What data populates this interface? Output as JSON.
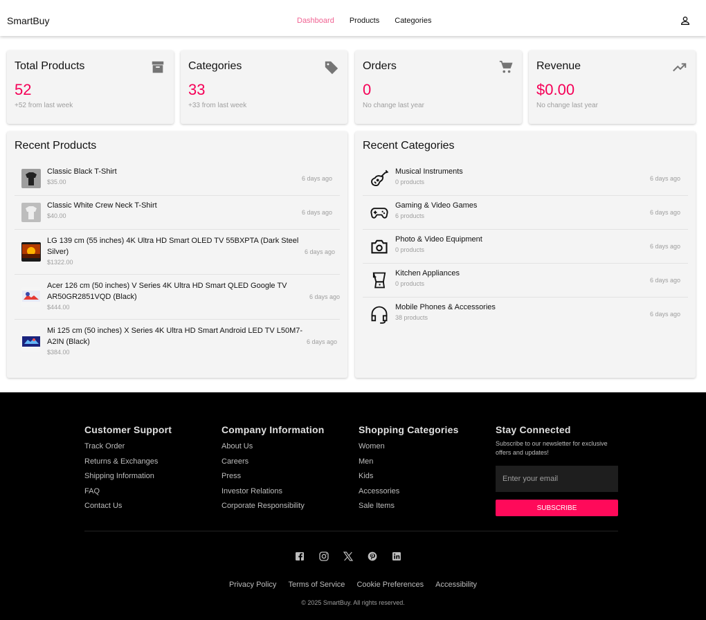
{
  "brand": "SmartBuy",
  "nav": {
    "links": [
      "Dashboard",
      "Products",
      "Categories"
    ],
    "active": "Dashboard"
  },
  "stats": [
    {
      "title": "Total Products",
      "value": "52",
      "sub": "+52 from last week",
      "icon": "archive-icon"
    },
    {
      "title": "Categories",
      "value": "33",
      "sub": "+33 from last week",
      "icon": "tag-icon"
    },
    {
      "title": "Orders",
      "value": "0",
      "sub": "No change last year",
      "icon": "cart-icon"
    },
    {
      "title": "Revenue",
      "value": "$0.00",
      "sub": "No change last year",
      "icon": "trending-up-icon"
    }
  ],
  "recent_products": {
    "title": "Recent Products",
    "items": [
      {
        "name": "Classic Black T-Shirt",
        "price": "$35.00",
        "time": "6 days ago"
      },
      {
        "name": "Classic White Crew Neck T-Shirt",
        "price": "$40.00",
        "time": "6 days ago"
      },
      {
        "name": "LG 139 cm (55 inches) 4K Ultra HD Smart OLED TV 55BXPTA (Dark Steel Silver)",
        "price": "$1322.00",
        "time": "6 days ago"
      },
      {
        "name": "Acer 126 cm (50 inches) V Series 4K Ultra HD Smart QLED Google TV AR50GR2851VQD (Black)",
        "price": "$444.00",
        "time": "6 days ago"
      },
      {
        "name": "Mi 125 cm (50 inches) X Series 4K Ultra HD Smart Android LED TV L50M7-A2IN (Black)",
        "price": "$384.00",
        "time": "6 days ago"
      }
    ]
  },
  "recent_categories": {
    "title": "Recent Categories",
    "items": [
      {
        "name": "Musical Instruments",
        "count": "0 products",
        "time": "6 days ago",
        "icon": "guitar-icon"
      },
      {
        "name": "Gaming & Video Games",
        "count": "6 products",
        "time": "6 days ago",
        "icon": "gamepad-icon"
      },
      {
        "name": "Photo & Video Equipment",
        "count": "0 products",
        "time": "6 days ago",
        "icon": "camera-icon"
      },
      {
        "name": "Kitchen Appliances",
        "count": "0 products",
        "time": "6 days ago",
        "icon": "blender-icon"
      },
      {
        "name": "Mobile Phones & Accessories",
        "count": "38 products",
        "time": "6 days ago",
        "icon": "headset-icon"
      }
    ]
  },
  "footer": {
    "columns": [
      {
        "heading": "Customer Support",
        "links": [
          "Track Order",
          "Returns & Exchanges",
          "Shipping Information",
          "FAQ",
          "Contact Us"
        ]
      },
      {
        "heading": "Company Information",
        "links": [
          "About Us",
          "Careers",
          "Press",
          "Investor Relations",
          "Corporate Responsibility"
        ]
      },
      {
        "heading": "Shopping Categories",
        "links": [
          "Women",
          "Men",
          "Kids",
          "Accessories",
          "Sale Items"
        ]
      }
    ],
    "newsletter": {
      "heading": "Stay Connected",
      "description": "Subscribe to our newsletter for exclusive offers and updates!",
      "placeholder": "Enter your email",
      "button": "SUBSCRIBE"
    },
    "socials": [
      "facebook-icon",
      "instagram-icon",
      "x-icon",
      "pinterest-icon",
      "linkedin-icon"
    ],
    "legal": [
      "Privacy Policy",
      "Terms of Service",
      "Cookie Preferences",
      "Accessibility"
    ],
    "copyright": "© 2025 SmartBuy. All rights reserved."
  },
  "colors": {
    "accent": "#f50057",
    "nav_active": "#f06292",
    "subscribe": "#ff0a5a"
  }
}
